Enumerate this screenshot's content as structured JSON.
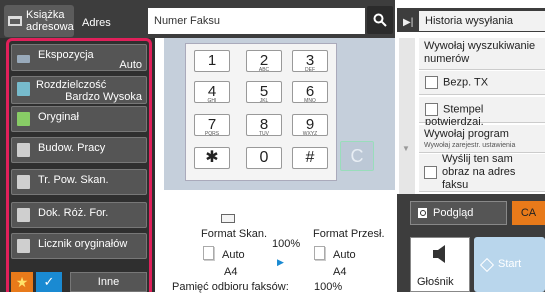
{
  "toolbar": {
    "address_book": "Książka adresowa",
    "address_tab": "Adres",
    "fax_number_placeholder": "Numer Faksu"
  },
  "left_menu": {
    "items": [
      {
        "label": "Ekspozycja",
        "value": "Auto"
      },
      {
        "label": "Rozdzielczość",
        "value": "Bardzo Wysoka"
      },
      {
        "label": "Oryginał",
        "value": ""
      },
      {
        "label": "Budow. Pracy",
        "value": ""
      },
      {
        "label": "Tr. Pow. Skan.",
        "value": ""
      },
      {
        "label": "Dok. Róż. For.",
        "value": ""
      },
      {
        "label": "Licznik oryginałów",
        "value": ""
      }
    ],
    "other_label": "Inne"
  },
  "keypad": {
    "keys": [
      {
        "digit": "1",
        "sub": ""
      },
      {
        "digit": "2",
        "sub": "ABC"
      },
      {
        "digit": "3",
        "sub": "DEF"
      },
      {
        "digit": "4",
        "sub": "GHI"
      },
      {
        "digit": "5",
        "sub": "JKL"
      },
      {
        "digit": "6",
        "sub": "MNO"
      },
      {
        "digit": "7",
        "sub": "PQRS"
      },
      {
        "digit": "8",
        "sub": "TUV"
      },
      {
        "digit": "9",
        "sub": "WXYZ"
      },
      {
        "digit": "✱",
        "sub": ""
      },
      {
        "digit": "0",
        "sub": ""
      },
      {
        "digit": "#",
        "sub": ""
      }
    ],
    "clear_label": "C"
  },
  "format": {
    "scan_label": "Format Skan.",
    "send_label": "Format Przesł.",
    "ratio": "100%",
    "scan_mode": "Auto",
    "send_mode": "Auto",
    "scan_size": "A4",
    "send_size": "A4",
    "memory_label": "Pamięć odbioru faksów:",
    "memory_value": "100%"
  },
  "right_panel": {
    "history": "Historia wysyłania",
    "recall_search": "Wywołaj wyszukiwanie numerów",
    "no_tx": "Bezp. TX",
    "confirm_stamp": "Stempel potwierdzaj.",
    "recall_program": "Wywołaj program",
    "recall_program_sub": "Wywołaj zarejestr. ustawienia",
    "send_same_image": "Wyślij ten sam obraz na adres faksu"
  },
  "bottom_right": {
    "preview": "Podgląd",
    "ca": "CA",
    "speaker": "Głośnik",
    "start": "Start"
  },
  "colors": {
    "highlight": "#e0205a",
    "accent_orange": "#e87a1a",
    "accent_blue": "#1a8ad2",
    "start_blue": "#b9d6ec"
  }
}
